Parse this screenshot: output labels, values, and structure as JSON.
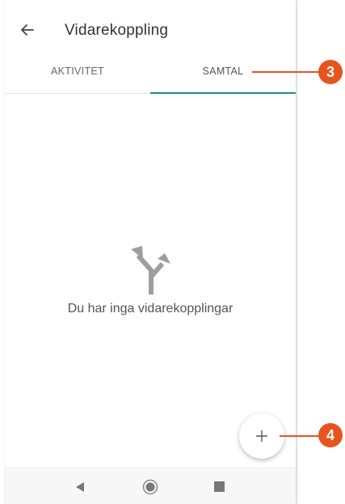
{
  "appbar": {
    "title": "Vidarekoppling",
    "back_icon": "arrow-left-icon"
  },
  "tabs": [
    {
      "label": "AKTIVITET",
      "selected": false
    },
    {
      "label": "SAMTAL",
      "selected": true
    }
  ],
  "empty_state": {
    "icon": "call-split-icon",
    "message": "Du har inga vidarekopplingar"
  },
  "fab": {
    "icon": "plus-icon"
  },
  "navbar": {
    "back_icon": "nav-back-triangle-icon",
    "home_icon": "nav-home-circle-icon",
    "recent_icon": "nav-recent-square-icon"
  },
  "callouts": [
    {
      "label": "3"
    },
    {
      "label": "4"
    }
  ],
  "colors": {
    "tab_indicator": "#1e8a87",
    "callout": "#e8541e",
    "icon_gray": "#9e9e9e"
  }
}
